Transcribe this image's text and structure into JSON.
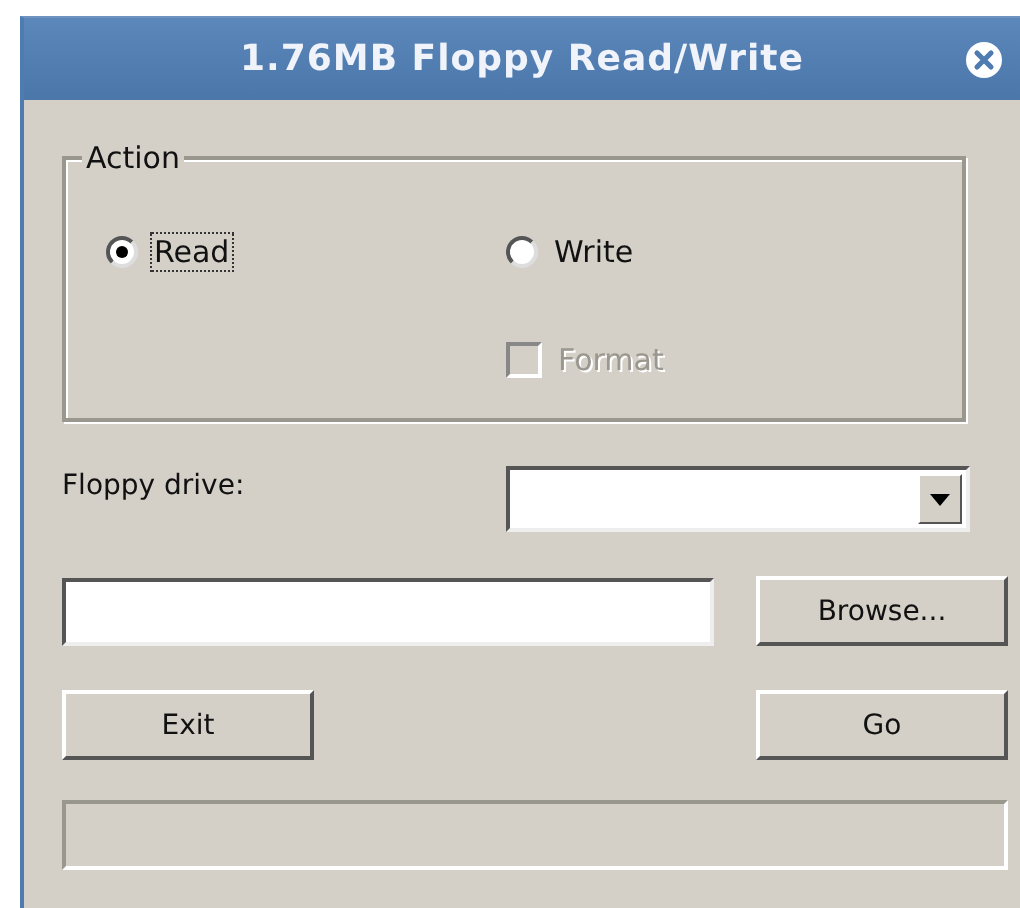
{
  "window": {
    "title": "1.76MB Floppy Read/Write"
  },
  "action_group": {
    "title": "Action",
    "options": [
      {
        "label": "Read",
        "kind": "radio",
        "selected": true,
        "focused": true,
        "disabled": false
      },
      {
        "label": "Write",
        "kind": "radio",
        "selected": false,
        "focused": false,
        "disabled": false
      },
      {
        "label": "Format",
        "kind": "checkbox",
        "checked": false,
        "focused": false,
        "disabled": true
      }
    ]
  },
  "floppy_drive": {
    "label": "Floppy drive:"
  },
  "buttons": {
    "browse": "Browse...",
    "exit": "Exit",
    "go": "Go"
  },
  "progress": {
    "level": 0
  }
}
